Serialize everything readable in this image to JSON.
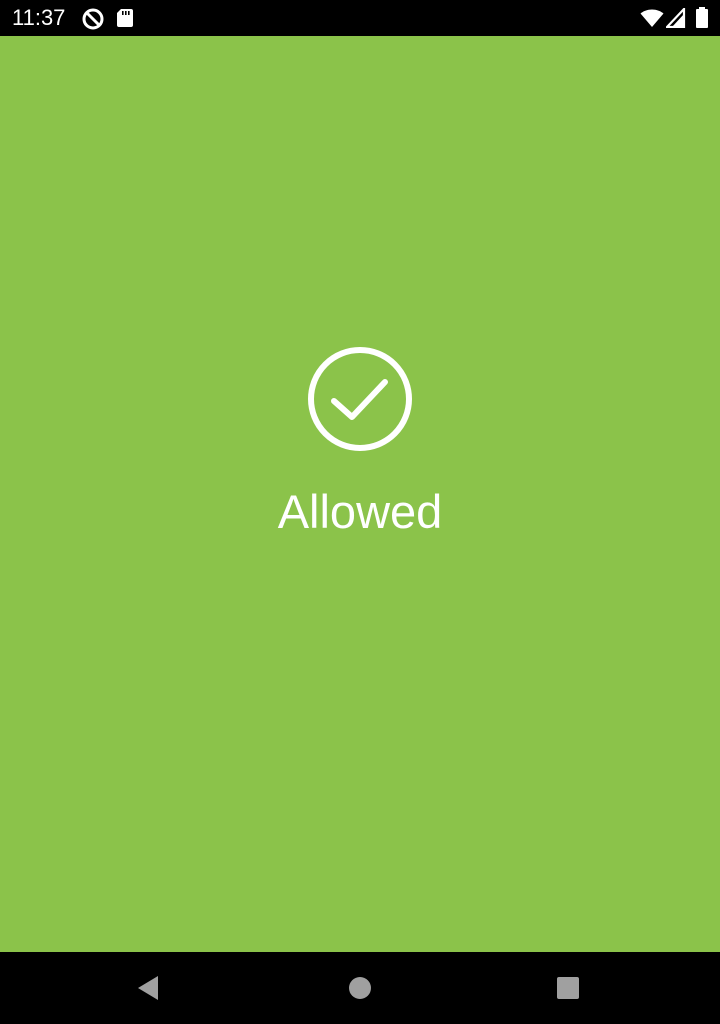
{
  "status_bar": {
    "time": "11:37",
    "icons_left": [
      "vpn-icon",
      "sd-card-icon"
    ],
    "icons_right": [
      "wifi-icon",
      "cell-signal-icon",
      "battery-icon"
    ]
  },
  "result": {
    "icon": "check-circle-icon",
    "label": "Allowed"
  },
  "nav_bar": {
    "buttons": [
      "back-icon",
      "home-icon",
      "recents-icon"
    ]
  },
  "colors": {
    "background": "#8BC34A",
    "foreground": "#FFFFFF",
    "system_bars": "#000000",
    "nav_icons": "#A0A0A0"
  }
}
